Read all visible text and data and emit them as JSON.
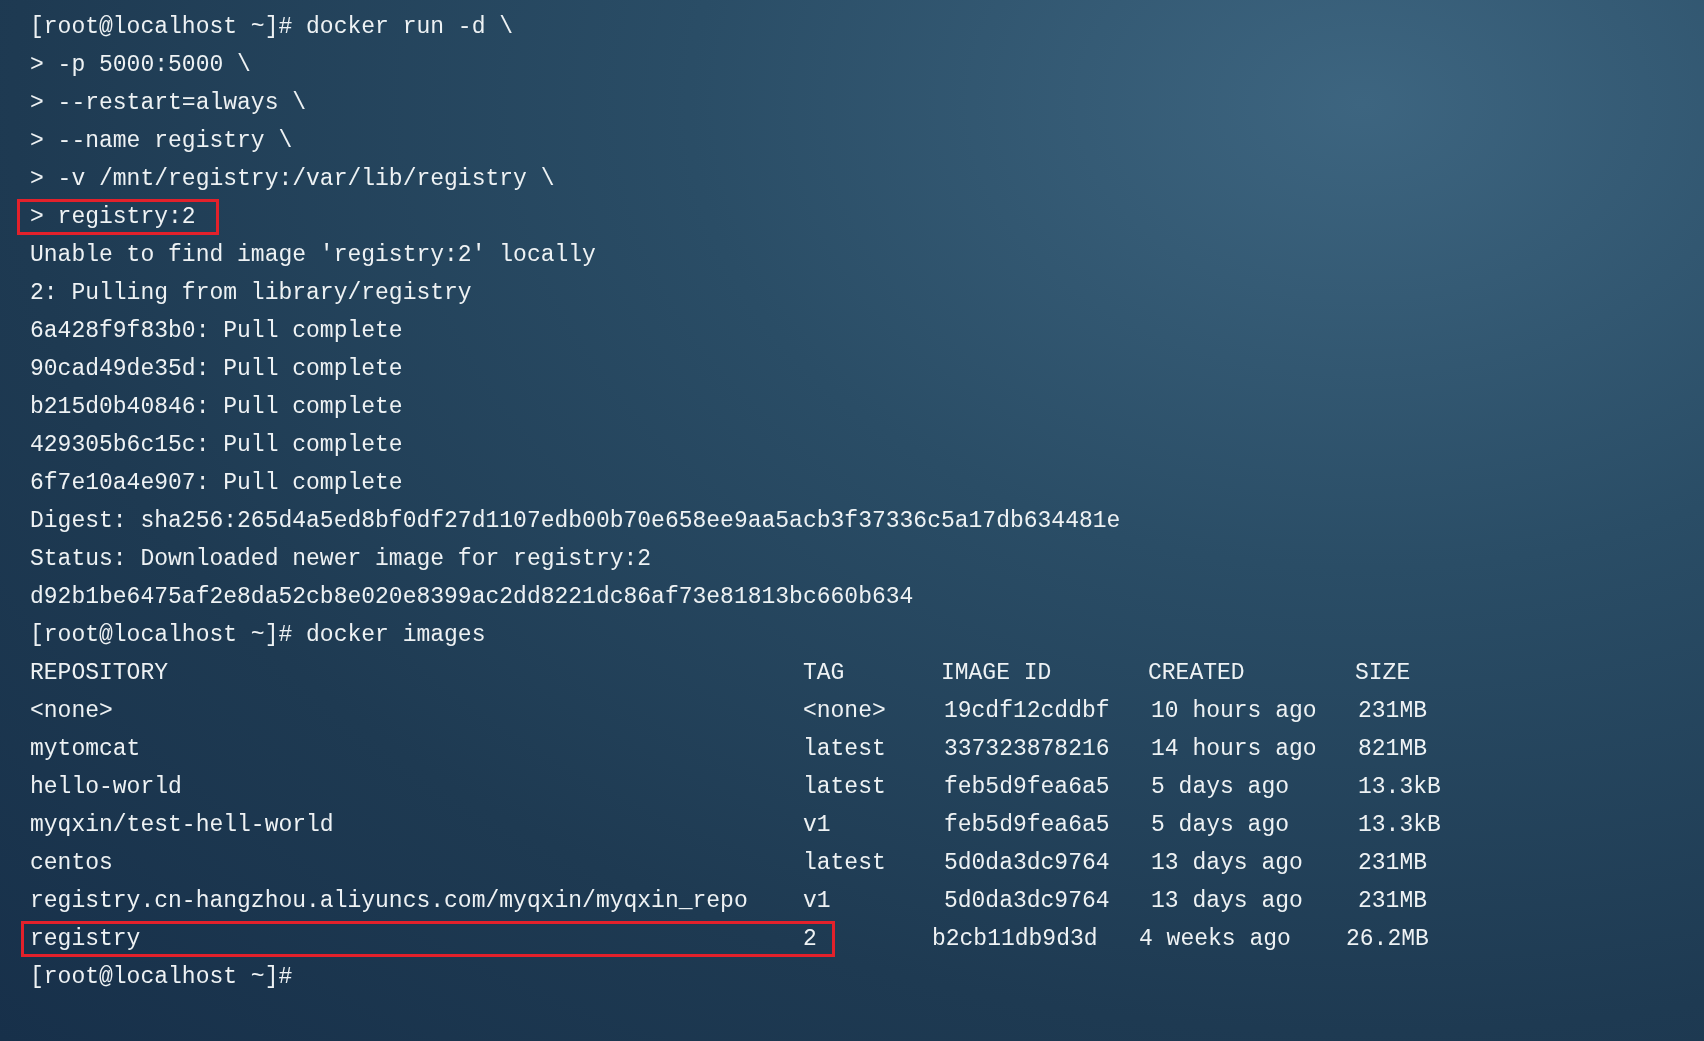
{
  "terminal": {
    "lines": [
      {
        "text": "[root@localhost ~]# docker run -d \\",
        "highlighted": false
      },
      {
        "text": "> -p 5000:5000 \\",
        "highlighted": false
      },
      {
        "text": "> --restart=always \\",
        "highlighted": false
      },
      {
        "text": "> --name registry \\",
        "highlighted": false
      },
      {
        "text": "> -v /mnt/registry:/var/lib/registry \\",
        "highlighted": false
      },
      {
        "text": "> registry:2",
        "highlighted": true
      },
      {
        "text": "Unable to find image 'registry:2' locally",
        "highlighted": false
      },
      {
        "text": "2: Pulling from library/registry",
        "highlighted": false
      },
      {
        "text": "6a428f9f83b0: Pull complete",
        "highlighted": false
      },
      {
        "text": "90cad49de35d: Pull complete",
        "highlighted": false
      },
      {
        "text": "b215d0b40846: Pull complete",
        "highlighted": false
      },
      {
        "text": "429305b6c15c: Pull complete",
        "highlighted": false
      },
      {
        "text": "6f7e10a4e907: Pull complete",
        "highlighted": false
      },
      {
        "text": "Digest: sha256:265d4a5ed8bf0df27d1107edb00b70e658ee9aa5acb3f37336c5a17db634481e",
        "highlighted": false
      },
      {
        "text": "Status: Downloaded newer image for registry:2",
        "highlighted": false
      },
      {
        "text": "d92b1be6475af2e8da52cb8e020e8399ac2dd8221dc86af73e81813bc660b634",
        "highlighted": false
      },
      {
        "text": "[root@localhost ~]# docker images",
        "highlighted": false
      }
    ],
    "table": {
      "columns": [
        "REPOSITORY",
        "TAG",
        "IMAGE ID",
        "CREATED",
        "SIZE"
      ],
      "rows": [
        {
          "cells": [
            "<none>",
            "<none>",
            "19cdf12cddbf",
            "10 hours ago",
            "231MB"
          ],
          "highlighted": false
        },
        {
          "cells": [
            "mytomcat",
            "latest",
            "337323878216",
            "14 hours ago",
            "821MB"
          ],
          "highlighted": false
        },
        {
          "cells": [
            "hello-world",
            "latest",
            "feb5d9fea6a5",
            "5 days ago",
            "13.3kB"
          ],
          "highlighted": false
        },
        {
          "cells": [
            "myqxin/test-hell-world",
            "v1",
            "feb5d9fea6a5",
            "5 days ago",
            "13.3kB"
          ],
          "highlighted": false
        },
        {
          "cells": [
            "centos",
            "latest",
            "5d0da3dc9764",
            "13 days ago",
            "231MB"
          ],
          "highlighted": false
        },
        {
          "cells": [
            "registry.cn-hangzhou.aliyuncs.com/myqxin/myqxin_repo",
            "v1",
            "5d0da3dc9764",
            "13 days ago",
            "231MB"
          ],
          "highlighted": false
        },
        {
          "cells": [
            "registry",
            "2",
            "b2cb11db9d3d",
            "4 weeks ago",
            "26.2MB"
          ],
          "highlighted": true
        }
      ]
    },
    "prompt": "[root@localhost ~]#"
  }
}
